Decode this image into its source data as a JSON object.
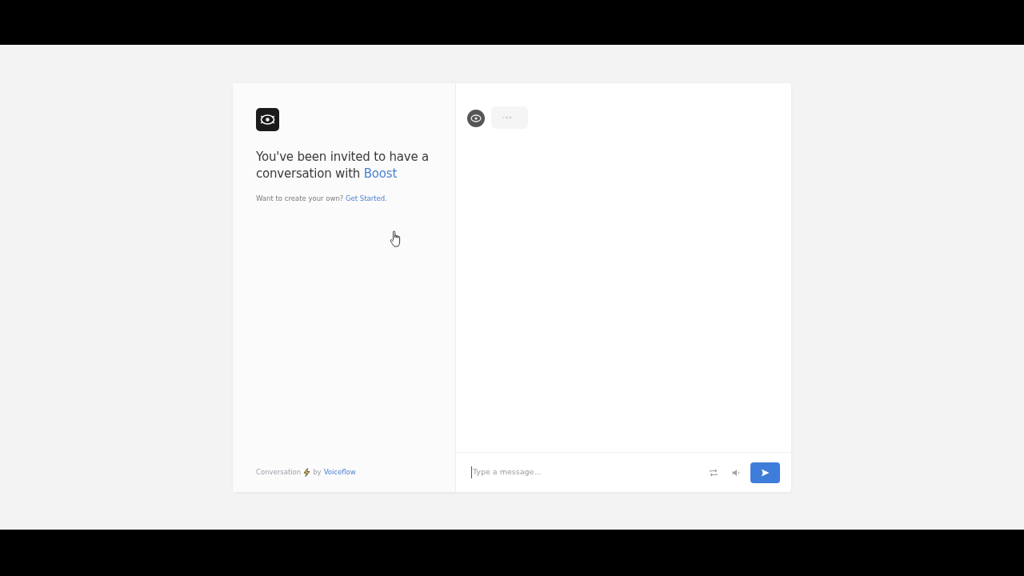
{
  "intro": {
    "heading": "You've been invited to have a conversation with",
    "assistant_name": "Boost",
    "prompt": "Want to create your own?",
    "prompt_link": "Get Started."
  },
  "footer": {
    "prefix": "Conversation",
    "by": "by",
    "brand": "Voiceflow"
  },
  "chat": {
    "typing": true
  },
  "composer": {
    "placeholder": "Type a message..."
  }
}
